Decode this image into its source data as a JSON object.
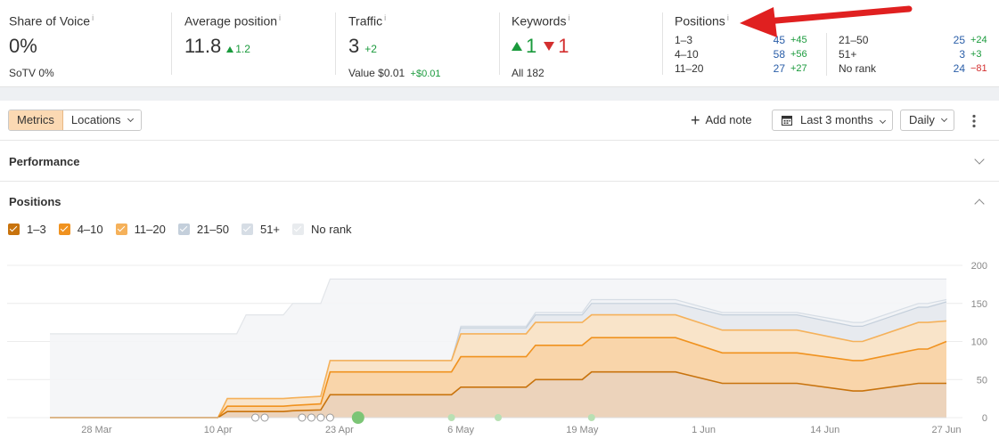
{
  "metrics": {
    "share_of_voice": {
      "title": "Share of Voice",
      "info": "i",
      "value": "0%",
      "sub_label": "SoTV",
      "sub_value": "0%"
    },
    "average_position": {
      "title": "Average position",
      "info": "i",
      "value": "11.8",
      "delta": "1.2"
    },
    "traffic": {
      "title": "Traffic",
      "info": "i",
      "value": "3",
      "delta": "+2",
      "sub_label": "Value",
      "sub_value": "$0.01",
      "sub_delta": "+$0.01"
    },
    "keywords": {
      "title": "Keywords",
      "info": "i",
      "up": "1",
      "down": "1",
      "sub_label": "All",
      "sub_value": "182"
    },
    "positions": {
      "title": "Positions",
      "info": "i",
      "left": [
        {
          "range": "1–3",
          "value": "45",
          "delta": "+45"
        },
        {
          "range": "4–10",
          "value": "58",
          "delta": "+56"
        },
        {
          "range": "11–20",
          "value": "27",
          "delta": "+27"
        }
      ],
      "right": [
        {
          "range": "21–50",
          "value": "25",
          "delta": "+24"
        },
        {
          "range": "51+",
          "value": "3",
          "delta": "+3"
        },
        {
          "range": "No rank",
          "value": "24",
          "delta": "−81"
        }
      ]
    }
  },
  "toolbar": {
    "metrics_tab": "Metrics",
    "locations_tab": "Locations",
    "add_note": "Add note",
    "date_range": "Last 3 months",
    "granularity": "Daily"
  },
  "sections": {
    "performance": "Performance",
    "positions": "Positions"
  },
  "legend": [
    {
      "label": "1–3",
      "color": "#c8730d"
    },
    {
      "label": "4–10",
      "color": "#f0921f"
    },
    {
      "label": "11–20",
      "color": "#f5b15a"
    },
    {
      "label": "21–50",
      "color": "#c4cfdb"
    },
    {
      "label": "51+",
      "color": "#d6dde5"
    },
    {
      "label": "No rank",
      "color": "#e8ebee"
    }
  ],
  "colors": {
    "accent_active": "#fbd9b3",
    "positive": "#1a9a3c",
    "negative": "#d32f2f",
    "link_blue": "#2a5ea8",
    "annotation_arrow": "#e02020"
  },
  "chart_data": {
    "type": "area",
    "x_tick_labels": [
      "28 Mar",
      "10 Apr",
      "23 Apr",
      "6 May",
      "19 May",
      "1 Jun",
      "14 Jun",
      "27 Jun"
    ],
    "y_tick_labels": [
      "200",
      "150",
      "100",
      "50",
      "0"
    ],
    "ylim": [
      0,
      200
    ],
    "x": [
      "23 Mar",
      "9 Apr",
      "10 Apr",
      "11 Apr",
      "12 Apr",
      "13 Apr",
      "17 Apr",
      "18 Apr",
      "21 Apr",
      "22 Apr",
      "25 Apr",
      "5 May",
      "6 May",
      "7 May",
      "13 May",
      "14 May",
      "19 May",
      "20 May",
      "28 May",
      "29 May",
      "3 Jun",
      "4 Jun",
      "10 Jun",
      "11 Jun",
      "17 Jun",
      "18 Jun",
      "24 Jun",
      "25 Jun",
      "27 Jun"
    ],
    "series": [
      {
        "name": "1–3",
        "values": [
          0,
          0,
          0,
          8,
          8,
          8,
          8,
          9,
          10,
          30,
          30,
          30,
          40,
          40,
          40,
          50,
          50,
          60,
          60,
          60,
          45,
          45,
          45,
          45,
          35,
          35,
          45,
          45,
          45
        ]
      },
      {
        "name": "4–10",
        "values": [
          0,
          0,
          0,
          15,
          15,
          15,
          15,
          16,
          18,
          60,
          60,
          60,
          80,
          80,
          80,
          95,
          95,
          105,
          105,
          105,
          85,
          85,
          85,
          85,
          75,
          75,
          90,
          90,
          100
        ]
      },
      {
        "name": "11–20",
        "values": [
          0,
          0,
          0,
          25,
          25,
          25,
          25,
          26,
          28,
          75,
          75,
          75,
          110,
          110,
          110,
          125,
          125,
          135,
          135,
          135,
          115,
          115,
          115,
          115,
          100,
          100,
          125,
          125,
          127
        ]
      },
      {
        "name": "21–50",
        "values": [
          0,
          0,
          0,
          25,
          25,
          25,
          25,
          26,
          28,
          75,
          75,
          75,
          118,
          118,
          118,
          135,
          135,
          150,
          150,
          150,
          135,
          135,
          135,
          135,
          120,
          120,
          145,
          145,
          152
        ]
      },
      {
        "name": "51+",
        "values": [
          0,
          0,
          0,
          25,
          25,
          25,
          25,
          26,
          28,
          75,
          75,
          75,
          120,
          120,
          120,
          138,
          138,
          155,
          155,
          155,
          138,
          138,
          138,
          138,
          125,
          125,
          150,
          150,
          155
        ]
      },
      {
        "name": "No rank",
        "values": [
          110,
          110,
          110,
          110,
          110,
          135,
          135,
          150,
          150,
          182,
          182,
          182,
          182,
          182,
          182,
          182,
          182,
          182,
          182,
          182,
          182,
          182,
          182,
          182,
          182,
          182,
          182,
          182,
          182
        ]
      }
    ]
  }
}
